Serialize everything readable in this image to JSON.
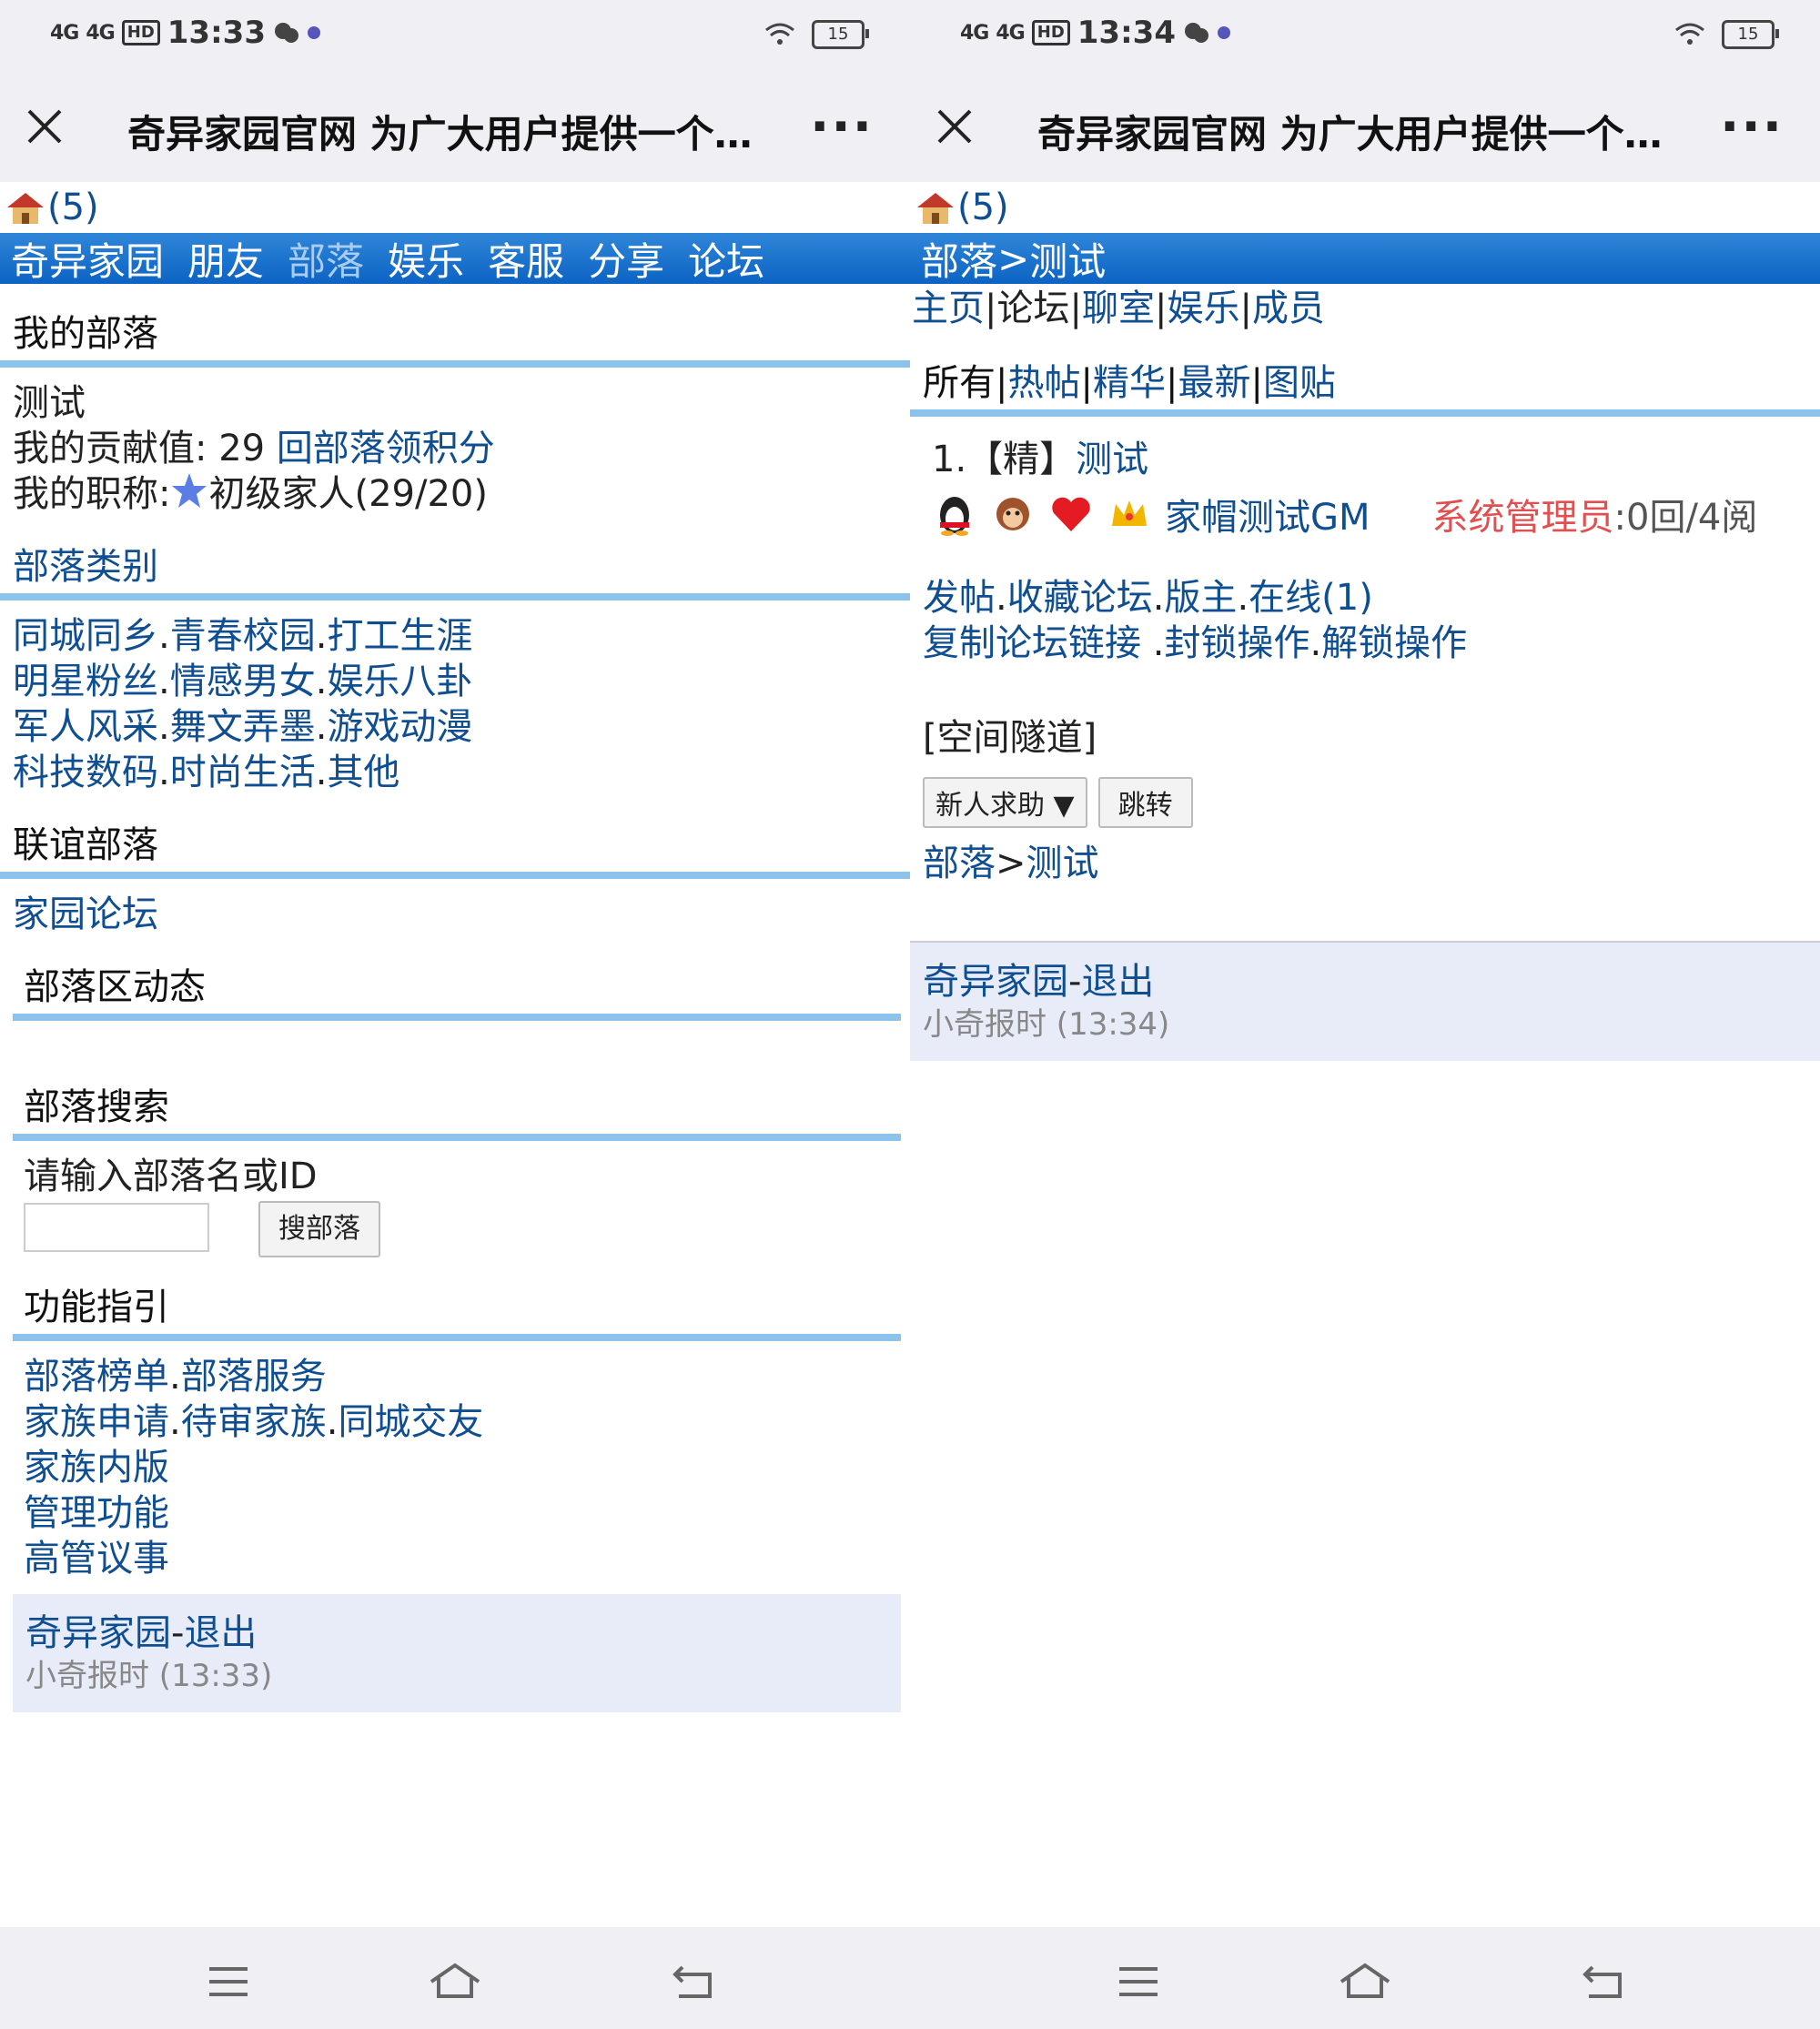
{
  "left": {
    "status": {
      "time": "13:33",
      "signal1": "4G",
      "signal2": "4G",
      "hd": "HD",
      "battery": "15"
    },
    "titlebar": {
      "title": "奇异家园官网 为广大用户提供一个…"
    },
    "badge_count": "(5)",
    "nav": [
      "奇异家园",
      "朋友",
      "部落",
      "娱乐",
      "客服",
      "分享",
      "论坛"
    ],
    "my_tribe": {
      "heading": "我的部落",
      "name": "测试",
      "contribution_label": "我的贡献值: 29",
      "contribution_link": "回部落领积分",
      "rank_label": "我的职称:",
      "rank_value": "初级家人(29/20)"
    },
    "categories": {
      "heading": "部落类别",
      "rows": [
        [
          "同城同乡",
          "青春校园",
          "打工生涯"
        ],
        [
          "明星粉丝",
          "情感男女",
          "娱乐八卦"
        ],
        [
          "军人风采",
          "舞文弄墨",
          "游戏动漫"
        ],
        [
          "科技数码",
          "时尚生活",
          "其他"
        ]
      ]
    },
    "alliance": {
      "heading": "联谊部落",
      "link": "家园论坛"
    },
    "dynamics": {
      "heading": "部落区动态"
    },
    "search": {
      "heading": "部落搜索",
      "prompt": "请输入部落名或ID",
      "input_value": "",
      "button": "搜部落"
    },
    "guide": {
      "heading": "功能指引",
      "rows": [
        [
          "部落榜单",
          "部落服务"
        ],
        [
          "家族申请",
          "待审家族",
          "同城交友"
        ],
        [
          "家族内版"
        ],
        [
          "管理功能"
        ],
        [
          "高管议事"
        ]
      ]
    },
    "footer": {
      "site": "奇异家园",
      "sep": "-",
      "logout": "退出",
      "time_text": "小奇报时 (13:33)"
    }
  },
  "right": {
    "status": {
      "time": "13:34",
      "signal1": "4G",
      "signal2": "4G",
      "hd": "HD",
      "battery": "15"
    },
    "titlebar": {
      "title": "奇异家园官网 为广大用户提供一个…"
    },
    "badge_count": "(5)",
    "breadcrumb": {
      "a": "部落",
      "sep": ">",
      "b": "测试"
    },
    "subnav": [
      "主页",
      "论坛",
      "聊室",
      "娱乐",
      "成员"
    ],
    "filter": {
      "current": "所有",
      "links": [
        "热帖",
        "精华",
        "最新",
        "图贴"
      ]
    },
    "post": {
      "index": "1.",
      "tag": "【精】",
      "title": "测试",
      "author": "家帽测试GM",
      "role": "系统管理员",
      "stats": ":0回/4阅"
    },
    "actions1": [
      "发帖",
      "收藏论坛",
      "版主",
      "在线(1)"
    ],
    "actions2": [
      "复制论坛链接 ",
      "封锁操作",
      "解锁操作"
    ],
    "tunnel": {
      "heading": "[空间隧道]",
      "select": "新人求助",
      "button": "跳转"
    },
    "breadcrumb2": {
      "a": "部落",
      "sep": ">",
      "b": "测试"
    },
    "footer": {
      "site": "奇异家园",
      "sep": "-",
      "logout": "退出",
      "time_text": "小奇报时 (13:34)"
    }
  }
}
